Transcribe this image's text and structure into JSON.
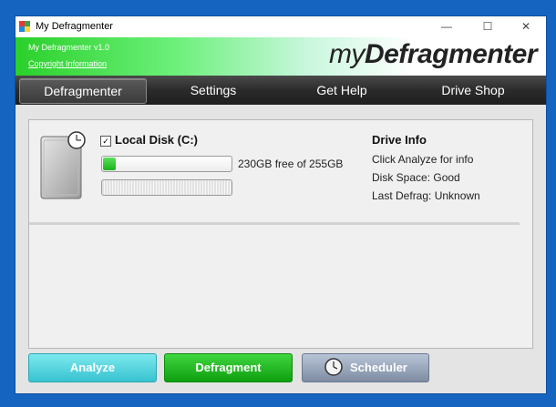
{
  "window": {
    "title": "My Defragmenter",
    "controls": {
      "minimize": "—",
      "maximize": "☐",
      "close": "✕"
    }
  },
  "banner": {
    "version": "My Defragmenter v1.0",
    "copyright_link": "Copyright Information",
    "logo_my": "my",
    "logo_main": "Defragmenter"
  },
  "nav": {
    "items": [
      {
        "label": "Defragmenter",
        "active": true
      },
      {
        "label": "Settings",
        "active": false
      },
      {
        "label": "Get Help",
        "active": false
      },
      {
        "label": "Drive Shop",
        "active": false
      }
    ]
  },
  "disk": {
    "checked": true,
    "check_mark": "✓",
    "label": "Local Disk (C:)",
    "free_text": "230GB free of 255GB",
    "used_fraction": 0.1,
    "usage_color": "#17b317"
  },
  "drive_info": {
    "title": "Drive Info",
    "lines": [
      "Click Analyze for info",
      "Disk Space: Good",
      "Last Defrag: Unknown"
    ]
  },
  "buttons": {
    "analyze": "Analyze",
    "defragment": "Defragment",
    "scheduler": "Scheduler"
  },
  "colors": {
    "desktop": "#1565c0",
    "banner_green": "#2ad02a",
    "analyze": "#36c3d0",
    "defragment": "#0f9f0f",
    "scheduler": "#7e8ca3"
  },
  "icons": [
    "app-grid-icon",
    "hard-drive-icon",
    "clock-icon"
  ]
}
